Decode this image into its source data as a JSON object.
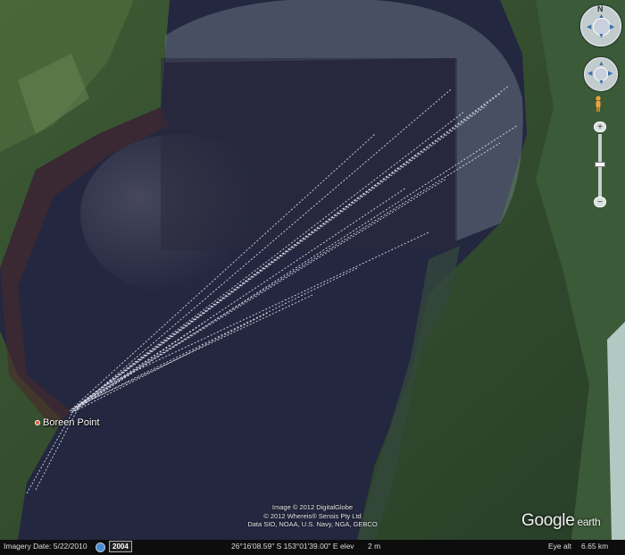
{
  "map": {
    "place_label": "Boreen Point",
    "attribution": [
      "Image © 2012 DigitalGlobe",
      "© 2012 Whereis® Sensis Pty Ltd",
      "Data SIO, NOAA, U.S. Navy, NGA, GEBCO"
    ],
    "logo": {
      "brand": "Google",
      "product": "earth"
    }
  },
  "status_bar": {
    "imagery_date": "Imagery Date: 5/22/2010",
    "year": "2004",
    "coordinates": "26°16'08.59\" S  153°01'39.00\" E  elev",
    "elevation": "2 m",
    "eye_alt_label": "Eye alt",
    "eye_alt_value": "6.65 km"
  },
  "nav": {
    "north_label": "N",
    "zoom_in": "+",
    "zoom_out": "−"
  },
  "colors": {
    "water": "#242740",
    "land": "#2f4a2c",
    "track": "#e6ecf5"
  }
}
